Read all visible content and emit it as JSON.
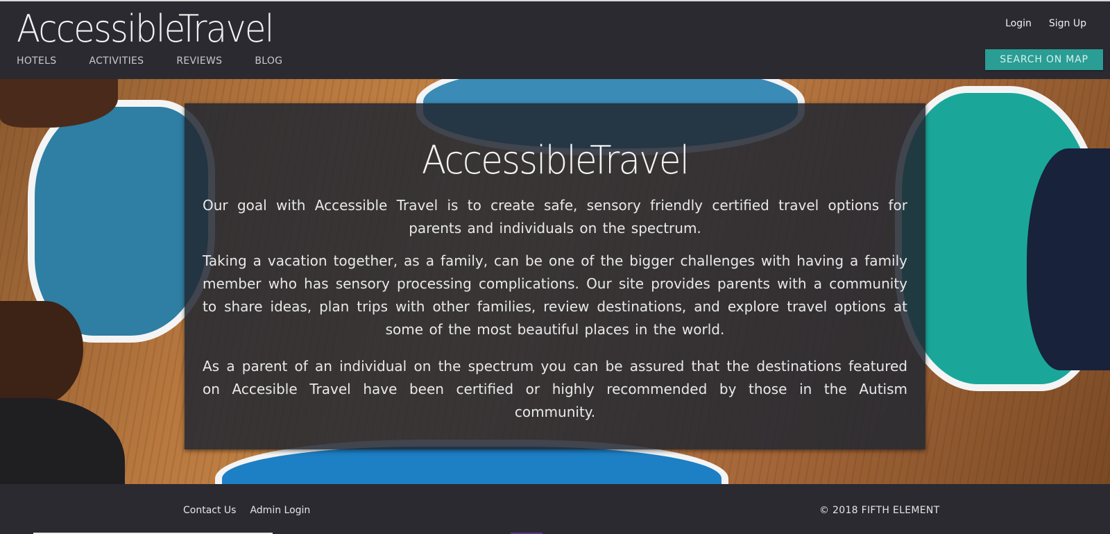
{
  "brand": {
    "name": "AccessibleTravel"
  },
  "nav": {
    "items": [
      {
        "label": "HOTELS"
      },
      {
        "label": "ACTIVITIES"
      },
      {
        "label": "REVIEWS"
      },
      {
        "label": "BLOG"
      }
    ]
  },
  "auth": {
    "login": "Login",
    "signup": "Sign Up"
  },
  "header": {
    "map_button": "SEARCH ON MAP"
  },
  "hero": {
    "title": "AccessibleTravel",
    "paragraphs": [
      "Our goal with Accessible Travel is to create safe, sensory friendly certified travel options for parents and individuals on the spectrum.",
      "Taking a vacation together, as a family, can be one of the bigger challenges with having a family member who has sensory processing complications. Our site provides parents with a community to share ideas, plan trips with other families, review destinations, and explore travel options at some of the most beautiful places in the world.",
      "As a parent of an individual on the spectrum you can be assured that the destinations featured on Accesible Travel have been certified or highly recommended by those in the Autism community."
    ]
  },
  "footer": {
    "links": [
      {
        "label": "Contact Us"
      },
      {
        "label": "Admin Login"
      }
    ],
    "copyright": "© 2018 FIFTH ELEMENT"
  },
  "colors": {
    "header_bg": "#2b2a31",
    "accent": "#2a9d94",
    "panel_bg": "rgba(34,40,50,0.86)"
  }
}
